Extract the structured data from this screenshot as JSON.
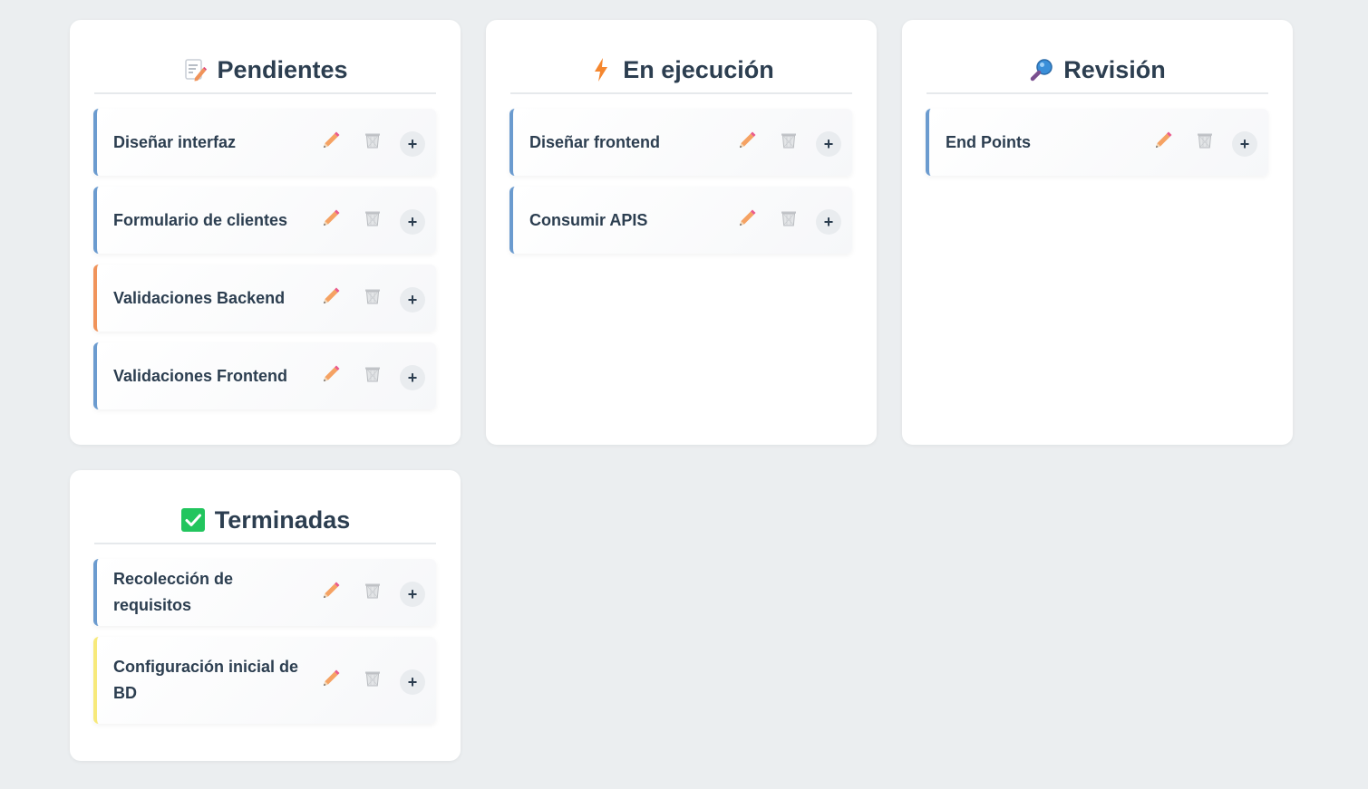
{
  "columns": [
    {
      "title": "Pendientes",
      "icon": "memo-icon",
      "cards": [
        {
          "text": "Diseñar interfaz",
          "color": "#6b9bcf"
        },
        {
          "text": "Formulario de clientes",
          "color": "#6b9bcf"
        },
        {
          "text": "Validaciones Backend",
          "color": "#f0935a"
        },
        {
          "text": "Validaciones Frontend",
          "color": "#6b9bcf"
        }
      ]
    },
    {
      "title": "En ejecución",
      "icon": "lightning-icon",
      "cards": [
        {
          "text": "Diseñar frontend",
          "color": "#6b9bcf"
        },
        {
          "text": "Consumir APIS",
          "color": "#6b9bcf"
        }
      ]
    },
    {
      "title": "Revisión",
      "icon": "magnifier-icon",
      "cards": [
        {
          "text": "End Points",
          "color": "#6b9bcf"
        }
      ]
    },
    {
      "title": "Terminadas",
      "icon": "check-icon",
      "cards": [
        {
          "text": "Recolección de requisitos",
          "color": "#6b9bcf"
        },
        {
          "text": "Configuración inicial de BD",
          "color": "#f7e97a"
        }
      ]
    }
  ],
  "actions": {
    "add_label": "+",
    "edit_icon": "pencil-icon",
    "delete_icon": "trash-icon"
  }
}
